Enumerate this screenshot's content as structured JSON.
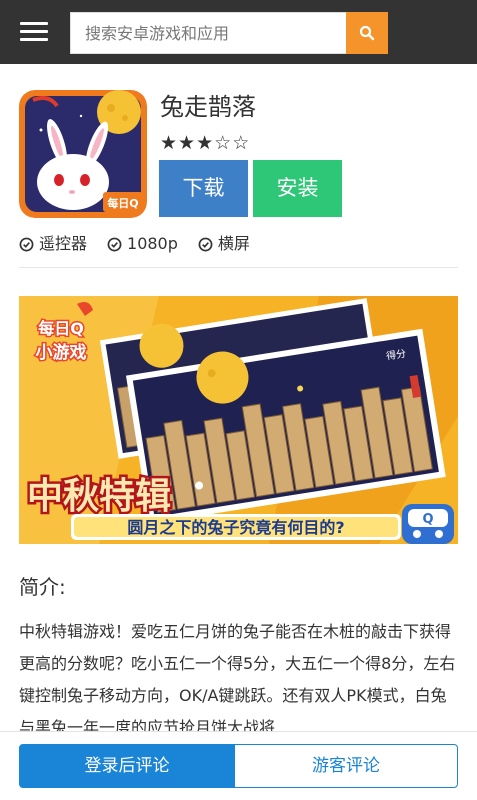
{
  "header": {
    "search_placeholder": "搜索安卓游戏和应用"
  },
  "app": {
    "title": "兔走鹊落",
    "rating": 3,
    "rating_max": 5,
    "icon_badge": "每日Q",
    "download_label": "下载",
    "install_label": "安装",
    "features": [
      "遥控器",
      "1080p",
      "横屏"
    ]
  },
  "banner": {
    "logo_line1": "每日Q",
    "logo_line2": "小游戏",
    "score_label": "得分",
    "headline": "中秋特辑",
    "subline": "圆月之下的兔子究竟有何目的?",
    "badge": "Q"
  },
  "intro": {
    "heading": "简介:",
    "text": "中秋特辑游戏！爱吃五仁月饼的兔子能否在木桩的敲击下获得更高的分数呢？吃小五仁一个得5分，大五仁一个得8分，左右键控制兔子移动方向，OK/A键跳跃。还有双人PK模式，白兔与黑兔一年一度的应节抢月饼大战将"
  },
  "bottom": {
    "login_comment": "登录后评论",
    "guest_comment": "游客评论"
  }
}
